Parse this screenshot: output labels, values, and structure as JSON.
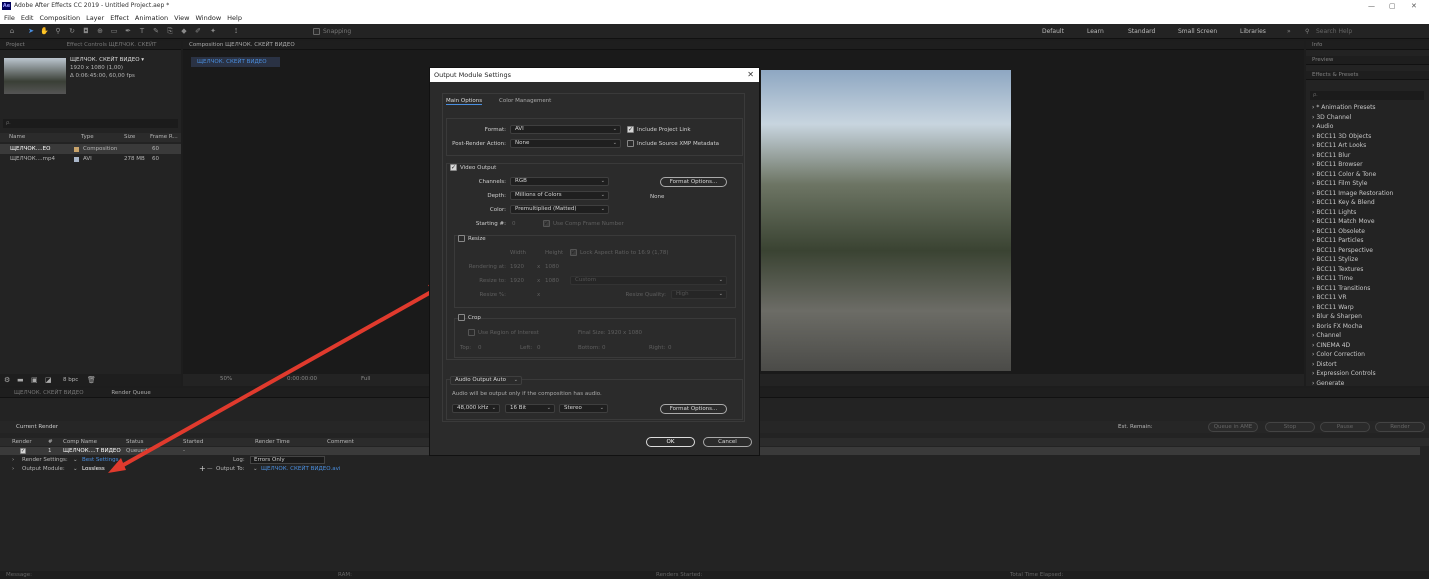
{
  "app": {
    "title": "Adobe After Effects CC 2019 - Untitled Project.aep *",
    "logo": "Ae"
  },
  "menu": [
    "File",
    "Edit",
    "Composition",
    "Layer",
    "Effect",
    "Animation",
    "View",
    "Window",
    "Help"
  ],
  "toolbar": {
    "snapping": "Snapping",
    "workspaces": [
      "Default",
      "Learn",
      "Standard",
      "Small Screen",
      "Libraries"
    ],
    "search_placeholder": "Search Help"
  },
  "project": {
    "tab": "Project",
    "effect_controls_tab": "Effect Controls ЩЕЛЧОК. СКЕЙТ",
    "comp_name": "ЩЕЛЧОК. СКЕЙТ ВИДЕО ▾",
    "comp_size": "1920 x 1080 (1,00)",
    "comp_duration": "Δ 0:06:45:00, 60,00 fps",
    "search_placeholder": "ρ.",
    "columns": [
      "Name",
      "Type",
      "Size",
      "Frame R..."
    ],
    "items": [
      {
        "name": "ЩЕЛЧОК....ЕО",
        "type": "Composition",
        "size": "",
        "fps": "60"
      },
      {
        "name": "ЩЕЛЧОК....mp4",
        "type": "AVI",
        "size": "278 MB",
        "fps": "60"
      }
    ],
    "bpc": "8 bpc"
  },
  "composition": {
    "tab": "Composition ЩЕЛЧОК. СКЕЙТ ВИДЕО",
    "sub_tab": "ЩЕЛЧОК. СКЕЙТ ВИДЕО",
    "zoom": "50%",
    "timecode": "0:00:00:00",
    "resolution": "Full"
  },
  "right_panel": {
    "info": "Info",
    "preview": "Preview",
    "effects_title": "Effects & Presets",
    "search_placeholder": "ρ.",
    "effects": [
      "* Animation Presets",
      "3D Channel",
      "Audio",
      "BCC11 3D Objects",
      "BCC11 Art Looks",
      "BCC11 Blur",
      "BCC11 Browser",
      "BCC11 Color & Tone",
      "BCC11 Film Style",
      "BCC11 Image Restoration",
      "BCC11 Key & Blend",
      "BCC11 Lights",
      "BCC11 Match Move",
      "BCC11 Obsolete",
      "BCC11 Particles",
      "BCC11 Perspective",
      "BCC11 Stylize",
      "BCC11 Textures",
      "BCC11 Time",
      "BCC11 Transitions",
      "BCC11 VR",
      "BCC11 Warp",
      "Blur & Sharpen",
      "Boris FX Mocha",
      "Channel",
      "CINEMA 4D",
      "Color Correction",
      "Distort",
      "Expression Controls",
      "Generate"
    ]
  },
  "render_queue": {
    "tab1": "ЩЕЛЧОК. СКЕЙТ ВИДЕО",
    "tab2": "Render Queue",
    "current_render": "Current Render",
    "est_remain": "Est. Remain:",
    "buttons": [
      "Queue in AME",
      "Stop",
      "Pause",
      "Render"
    ],
    "columns": [
      "Render",
      "#",
      "Comp Name",
      "Status",
      "Started",
      "Render Time",
      "Comment"
    ],
    "item": {
      "num": "1",
      "comp": "ЩЕЛЧОК....Т ВИДЕО",
      "status": "Queued",
      "started": "-"
    },
    "render_settings_label": "Render Settings:",
    "render_settings_value": "Best Settings",
    "log_label": "Log:",
    "log_value": "Errors Only",
    "output_module_label": "Output Module:",
    "output_module_value": "Lossless",
    "output_to_label": "Output To:",
    "output_to_value": "ЩЕЛЧОК. СКЕЙТ ВИДЕО.avi",
    "status_bar": [
      "Message:",
      "RAM:",
      "Renders Started:",
      "Total Time Elapsed:"
    ]
  },
  "dialog": {
    "title": "Output Module Settings",
    "tabs": [
      "Main Options",
      "Color Management"
    ],
    "format_label": "Format:",
    "format_value": "AVI",
    "post_render_label": "Post-Render Action:",
    "post_render_value": "None",
    "include_project_link": "Include Project Link",
    "include_xmp": "Include Source XMP Metadata",
    "video_output": "Video Output",
    "channels_label": "Channels:",
    "channels_value": "RGB",
    "depth_label": "Depth:",
    "depth_value": "Millions of Colors",
    "color_label": "Color:",
    "color_value": "Premultiplied (Matted)",
    "starting_label": "Starting #:",
    "starting_value": "0",
    "use_comp_frame": "Use Comp Frame Number",
    "format_options": "Format Options...",
    "format_none": "None",
    "resize": "Resize",
    "width": "Width",
    "height": "Height",
    "lock_aspect": "Lock Aspect Ratio to 16:9 (1,78)",
    "rendering_at": "Rendering at:",
    "resize_to": "Resize to:",
    "resize_pct": "Resize %:",
    "w": "1920",
    "h": "1080",
    "x": "x",
    "custom": "Custom",
    "resize_quality": "Resize Quality:",
    "quality_value": "High",
    "crop": "Crop",
    "use_roi": "Use Region of Interest",
    "final_size": "Final Size: 1920 x 1080",
    "top": "Top:",
    "left": "Left:",
    "bottom": "Bottom:",
    "right": "Right:",
    "zero": "0",
    "audio_output": "Audio Output Auto",
    "audio_note": "Audio will be output only if the composition has audio.",
    "sample_rate": "48,000 kHz",
    "bit_depth": "16 Bit",
    "stereo": "Stereo",
    "audio_format_options": "Format Options...",
    "ok": "OK",
    "cancel": "Cancel"
  }
}
